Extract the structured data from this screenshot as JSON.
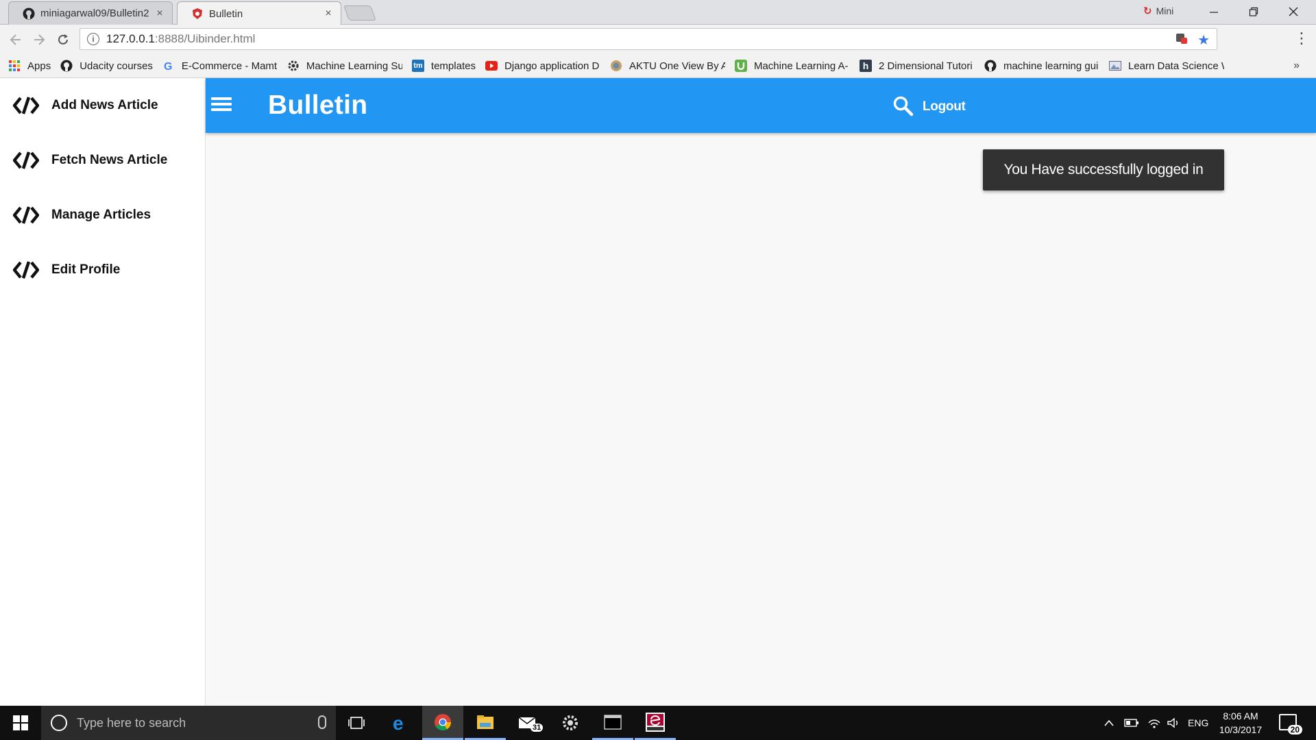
{
  "browser": {
    "tabs": [
      {
        "title": "miniagarwal09/Bulletin2",
        "close": "×"
      },
      {
        "title": "Bulletin",
        "close": "×"
      }
    ],
    "profile_name": "Mini",
    "url_host": "127.0.0.1",
    "url_path": ":8888/Uibinder.html",
    "bookmarks": [
      {
        "label": "Apps",
        "icon": "apps-grid-icon"
      },
      {
        "label": "Udacity courses",
        "icon": "github-icon"
      },
      {
        "label": "E-Commerce - Mamt",
        "icon": "google-icon"
      },
      {
        "label": "Machine Learning Su",
        "icon": "gear-icon"
      },
      {
        "label": "templates",
        "icon": "tm-icon"
      },
      {
        "label": "Django application D",
        "icon": "youtube-icon"
      },
      {
        "label": "AKTU One View By A",
        "icon": "emblem-icon"
      },
      {
        "label": "Machine Learning A-",
        "icon": "udemy-icon"
      },
      {
        "label": "2 Dimensional Tutori",
        "icon": "h-icon"
      },
      {
        "label": "machine learning gui",
        "icon": "github-icon"
      },
      {
        "label": "Learn Data Science W",
        "icon": "image-icon"
      }
    ],
    "tm_text": "tm",
    "h_text": "h",
    "more": "»"
  },
  "drawer": {
    "items": [
      {
        "label": "Add News Article"
      },
      {
        "label": "Fetch News Article"
      },
      {
        "label": "Manage Articles"
      },
      {
        "label": "Edit Profile"
      }
    ]
  },
  "appbar": {
    "title": "Bulletin",
    "logout_label": "Logout"
  },
  "toast": {
    "message": "You Have successfully logged in"
  },
  "taskbar": {
    "search_placeholder": "Type here to search",
    "mail_badge": "31",
    "language": "ENG",
    "time": "8:06 AM",
    "date": "10/3/2017",
    "notification_count": "20"
  },
  "colors": {
    "appbar": "#2196f3",
    "toast_bg": "#323232",
    "drawer_bg": "#ffffff",
    "page_bg": "#f8f8f8"
  }
}
